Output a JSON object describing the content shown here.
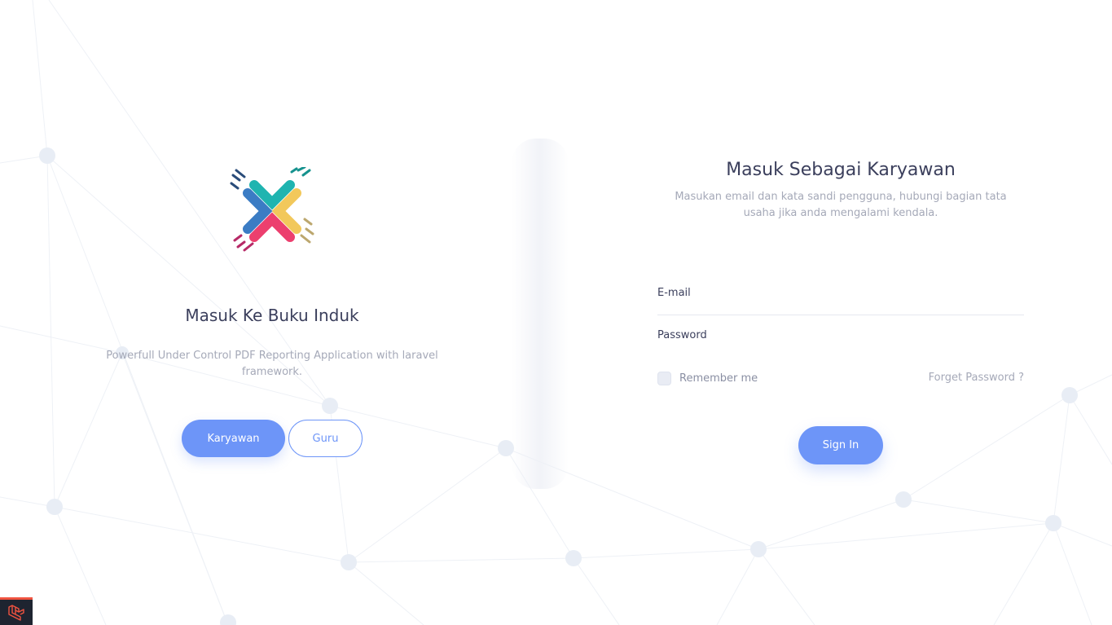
{
  "left_panel": {
    "logo_name": "buku-induk-logo",
    "title": "Masuk Ke Buku Induk",
    "description": "Powerfull Under Control PDF Reporting Application with laravel framework.",
    "buttons": {
      "karyawan_label": "Karyawan",
      "guru_label": "Guru"
    }
  },
  "login_form": {
    "title": "Masuk Sebagai Karyawan",
    "description": "Masukan email dan kata sandi pengguna, hubungi bagian tata usaha jika anda mengalami kendala.",
    "email": {
      "label": "E-mail",
      "value": "",
      "placeholder": ""
    },
    "password": {
      "label": "Password",
      "value": "",
      "placeholder": ""
    },
    "remember_label": "Remember me",
    "remember_checked": false,
    "forget_label": "Forget Password ?",
    "signin_label": "Sign In"
  },
  "debug_bar": {
    "icon": "laravel-icon"
  },
  "colors": {
    "primary": "#6d95f8",
    "title": "#3b3f5c",
    "muted": "#a5a9b8",
    "network_dot": "#e8edf5",
    "debug_red": "#f05340"
  }
}
